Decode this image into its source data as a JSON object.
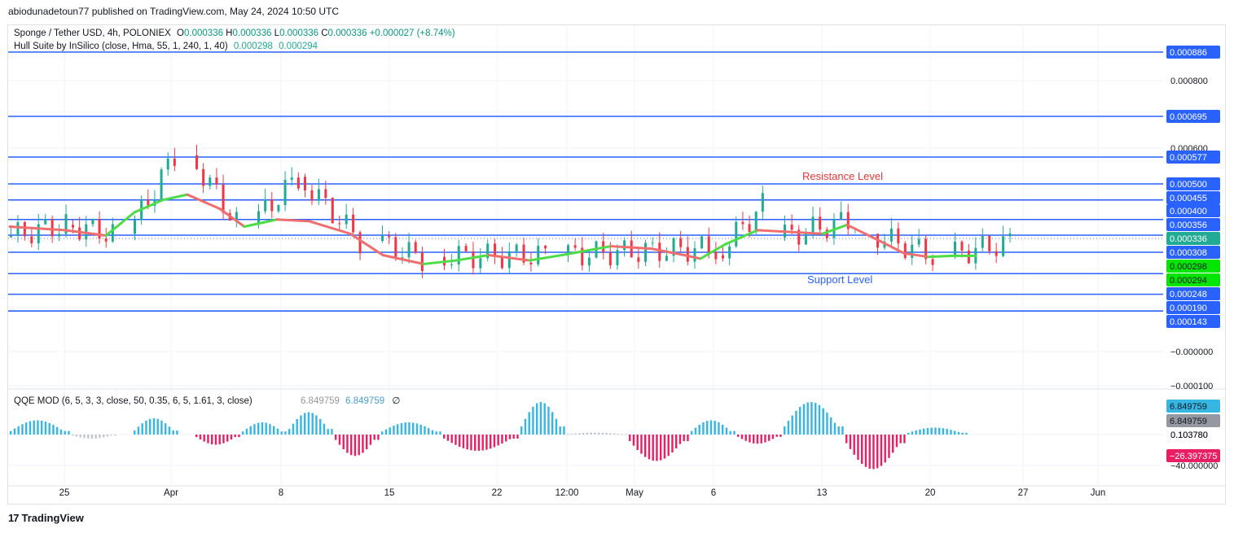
{
  "caption": "abiodunadetoun77 published on TradingView.com, May 24, 2024 10:50 UTC",
  "legend_main": {
    "symbol": "Sponge / Tether USD, 4h, POLONIEX",
    "o_label": "O",
    "o": "0.000336",
    "h_label": "H",
    "h": "0.000336",
    "l_label": "L",
    "l": "0.000336",
    "c_label": "C",
    "c": "0.000336",
    "change": "+0.000027 (+8.74%)"
  },
  "legend_hull": {
    "name": "Hull Suite by InSilico (close, Hma, 55, 1, 240, 1, 40)",
    "v1": "0.000298",
    "v2": "0.000294"
  },
  "legend_qqe": {
    "name": "QQE MOD (6, 5, 3, 3, close, 50, 0.35, 6, 5, 1.61, 3, close)",
    "v1": "6.849759",
    "v2": "6.849759",
    "symbol": "∅"
  },
  "annotations": {
    "resistance": "Resistance Level",
    "support": "Support Level"
  },
  "footer": {
    "brand": "TradingView",
    "mark": "17"
  },
  "colors": {
    "up": "#22ab94",
    "down": "#f23645",
    "level": "#2962ff",
    "hull_up": "#4cdc46",
    "hull_down": "#f06e6e",
    "qqe_blue": "#35b6e3",
    "qqe_red": "#e91e63",
    "qqe_grey": "#c2c6ce",
    "resistance_text": "#e53935",
    "support_text": "#2962ff"
  },
  "chart_data": [
    {
      "type": "candlestick",
      "title": "Sponge / Tether USD, 4h, POLONIEX",
      "y_axis_ticks": [
        "0.000800",
        "0.000600",
        "−0.000000",
        "−0.000100"
      ],
      "x_axis_ticks": [
        "25",
        "Apr",
        "8",
        "15",
        "22",
        "12:00",
        "May",
        "6",
        "13",
        "20",
        "27",
        "Jun"
      ],
      "horizontal_levels": [
        0.000886,
        0.000695,
        0.000577,
        0.0005,
        0.000455,
        0.0004,
        0.000356,
        0.000308,
        0.000248,
        0.00019,
        0.000143
      ],
      "price_labels": {
        "levels": [
          "0.000886",
          "0.000695",
          "0.000577",
          "0.000500",
          "0.000455",
          "0.000400",
          "0.000356",
          "0.000308",
          "0.000248",
          "0.000190",
          "0.000143"
        ],
        "last_price": "0.000336",
        "hull_upper": "0.000298",
        "hull_lower": "0.000294"
      },
      "last_price": 0.000336,
      "hull_suite": {
        "value_1": 0.000298,
        "value_2": 0.000294
      },
      "candles_approx": [
        {
          "period": "Mar 20–Mar 24",
          "open": 0.00035,
          "close": 0.000385
        },
        {
          "period": "Mar 24–Mar 27",
          "open": 0.000385,
          "close": 0.00036
        },
        {
          "period": "Mar 28–Mar 31",
          "open": 0.00036,
          "close": 0.00058
        },
        {
          "period": "Apr 1–Apr 4",
          "open": 0.00058,
          "close": 0.00039
        },
        {
          "period": "Apr 5–Apr 8",
          "open": 0.00039,
          "close": 0.00052
        },
        {
          "period": "Apr 8–Apr 12",
          "open": 0.00052,
          "close": 0.00034
        },
        {
          "period": "Apr 13–Apr 16",
          "open": 0.00034,
          "close": 0.00029
        },
        {
          "period": "Apr 17–Apr 24",
          "open": 0.000295,
          "close": 0.0003
        },
        {
          "period": "Apr 25–May 5",
          "open": 0.0003,
          "close": 0.00032
        },
        {
          "period": "May 5–May 8",
          "open": 0.0003,
          "close": 0.00044
        },
        {
          "period": "May 9–May 14",
          "open": 0.00035,
          "close": 0.0004
        },
        {
          "period": "May 15–May 19",
          "open": 0.00036,
          "close": 0.0003
        },
        {
          "period": "May 20–May 24",
          "open": 0.0003,
          "close": 0.000336
        }
      ]
    },
    {
      "type": "bar",
      "title": "QQE MOD (6, 5, 3, 3, close, 50, 0.35, 6, 5, 1.61, 3, close)",
      "y_axis_ticks": [
        "0.103780",
        "−40.000000"
      ],
      "price_labels": {
        "top": "6.849759",
        "second": "6.849759",
        "mid": "0.103780",
        "negative": "−26.397375"
      },
      "values_approx": [
        {
          "period": "Mar 20–Mar 24",
          "value": 14
        },
        {
          "period": "Mar 25–Mar 27",
          "value": -4
        },
        {
          "period": "Mar 28–Mar 31",
          "value": 16
        },
        {
          "period": "Apr 1–Apr 4",
          "value": -10
        },
        {
          "period": "Apr 5–Apr 8",
          "value": 12
        },
        {
          "period": "Apr 9–Apr 11",
          "value": 22
        },
        {
          "period": "Apr 12–Apr 17",
          "value": -21
        },
        {
          "period": "Apr 18–Apr 21",
          "value": 12
        },
        {
          "period": "Apr 22–Apr 27",
          "value": -16
        },
        {
          "period": "Apr 28–May 1",
          "value": 32
        },
        {
          "period": "May 2–May 4",
          "value": 2
        },
        {
          "period": "May 5–May 6",
          "value": -26
        },
        {
          "period": "May 7–May 9",
          "value": 14
        },
        {
          "period": "May 10–May 12",
          "value": -9
        },
        {
          "period": "May 13–May 15",
          "value": 32
        },
        {
          "period": "May 16–May 19",
          "value": -34
        },
        {
          "period": "May 20–May 24",
          "value": 6.849759
        }
      ]
    }
  ]
}
